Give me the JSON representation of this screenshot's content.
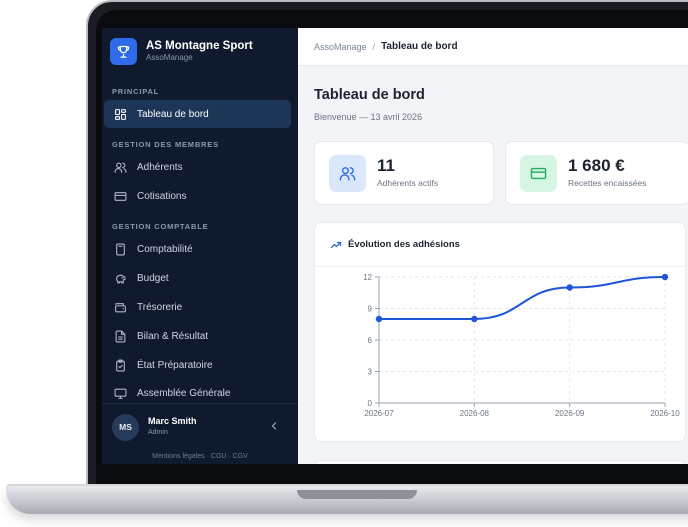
{
  "brand": {
    "name": "AS Montagne Sport",
    "sub": "AssoManage"
  },
  "sidebar": {
    "sections": [
      {
        "label": "PRINCIPAL"
      },
      {
        "label": "GESTION DES MEMBRES"
      },
      {
        "label": "GESTION COMPTABLE"
      }
    ],
    "items": [
      {
        "label": "Tableau de bord",
        "icon": "dashboard-icon",
        "active": true
      },
      {
        "label": "Adhérents",
        "icon": "users-icon"
      },
      {
        "label": "Cotisations",
        "icon": "credit-card-icon"
      },
      {
        "label": "Comptabilité",
        "icon": "calculator-icon"
      },
      {
        "label": "Budget",
        "icon": "piggy-bank-icon"
      },
      {
        "label": "Trésorerie",
        "icon": "wallet-icon"
      },
      {
        "label": "Bilan & Résultat",
        "icon": "document-icon"
      },
      {
        "label": "État Préparatoire",
        "icon": "clipboard-check-icon"
      },
      {
        "label": "Assemblée Générale",
        "icon": "monitor-icon"
      }
    ]
  },
  "user": {
    "initials": "MS",
    "name": "Marc Smith",
    "role": "Admin"
  },
  "footer": {
    "links": "Mentions légales · CGU · CGV"
  },
  "breadcrumb": {
    "root": "AssoManage",
    "separator": "/",
    "current": "Tableau de bord"
  },
  "page": {
    "title": "Tableau de bord",
    "subtitle": "Bienvenue — 13 avril 2026"
  },
  "stats": [
    {
      "value": "11",
      "label": "Adhérents actifs",
      "icon": "users-icon",
      "color": "#dbe8fb"
    },
    {
      "value": "1 680 €",
      "label": "Recettes encaissées",
      "icon": "credit-card-icon",
      "color": "#d6f5e3"
    }
  ],
  "colors": {
    "sidebar_bg": "#0f1a2e",
    "active_item": "#1d3658",
    "accent": "#2f6ae8",
    "line": "#1e55d9"
  },
  "chart_data": {
    "type": "line",
    "title": "Évolution des adhésions",
    "x": [
      "2026-07",
      "2026-08",
      "2026-09",
      "2026-10"
    ],
    "series": [
      {
        "values": [
          8,
          8,
          11,
          12
        ]
      }
    ],
    "yticks": [
      0,
      3,
      6,
      9,
      12
    ],
    "ylim": [
      0,
      12
    ],
    "grid": true
  }
}
